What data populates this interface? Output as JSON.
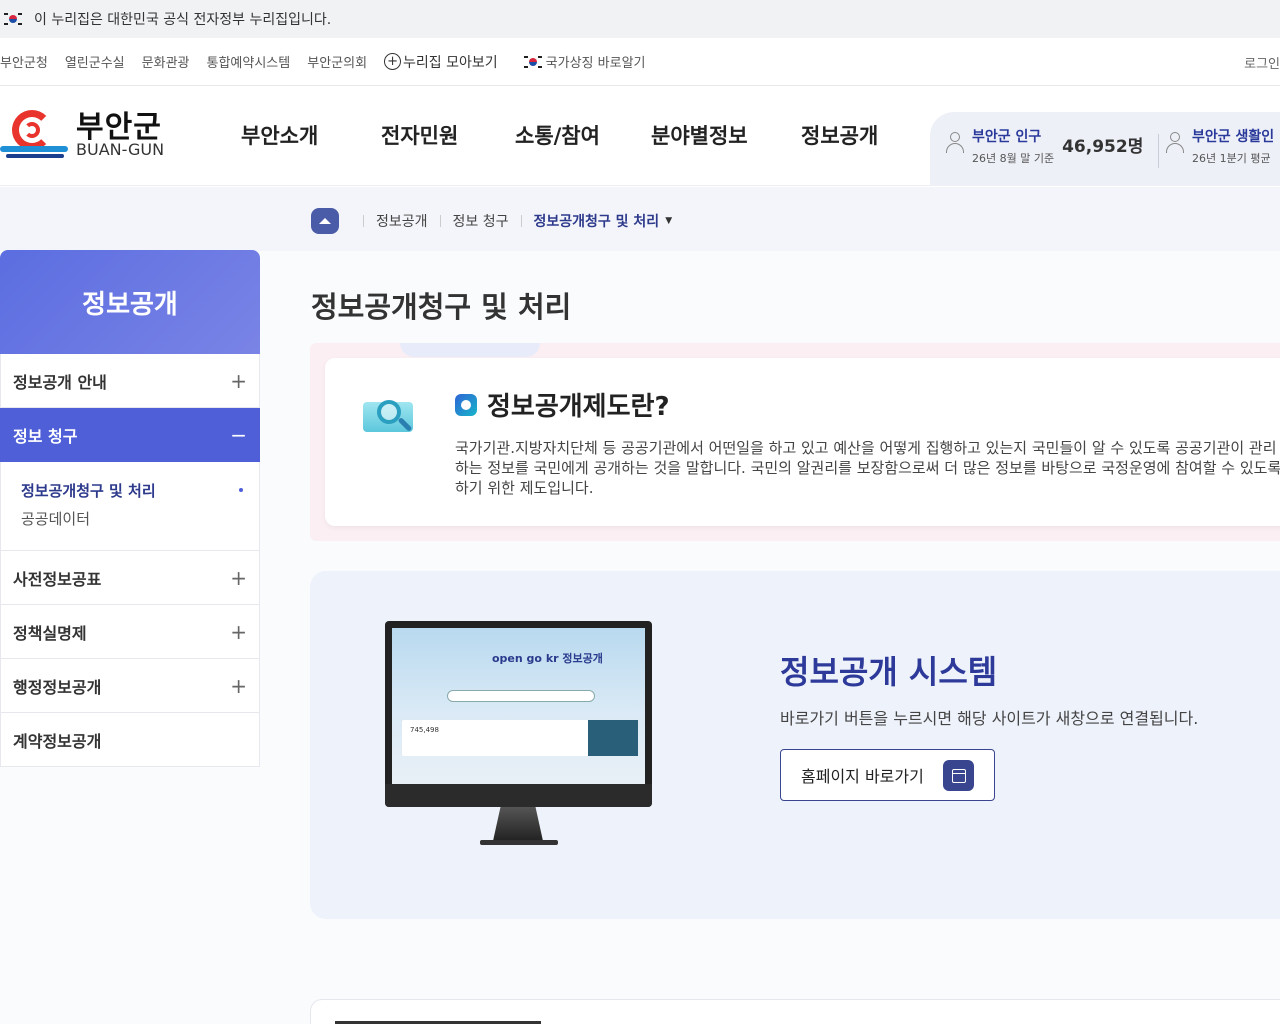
{
  "gov_banner": {
    "text": "이 누리집은 대한민국 공식 전자정부 누리집입니다."
  },
  "util_bar": {
    "links": [
      "부안군청",
      "열린군수실",
      "문화관광",
      "통합예약시스템",
      "부안군의회"
    ],
    "nurijip_all": "누리집 모아보기",
    "national_symbol": "국가상징 바로알기",
    "login": "로그인"
  },
  "logo": {
    "korean": "부안군",
    "english": "BUAN-GUN"
  },
  "gnb": {
    "items": [
      {
        "label": "부안소개"
      },
      {
        "label": "전자민원"
      },
      {
        "label": "소통/참여"
      },
      {
        "label": "분야별정보"
      },
      {
        "label": "정보공개"
      }
    ]
  },
  "stats": {
    "population": {
      "label": "부안군 인구",
      "sub": "26년 8월 말 기준",
      "value": "46,952명"
    },
    "living": {
      "label": "부안군 생활인",
      "sub": "26년 1분기 평균"
    }
  },
  "breadcrumb": {
    "items": [
      "정보공개",
      "정보 청구"
    ],
    "current": "정보공개청구 및 처리",
    "caret": "▼"
  },
  "lnb": {
    "title": "정보공개",
    "sign_plus": "+",
    "sign_minus": "−",
    "items": [
      "정보공개 안내",
      "정보 청구",
      "사전정보공표",
      "정책실명제",
      "행정정보공개",
      "계약정보공개"
    ],
    "active_sub": [
      "정보공개청구 및 처리",
      "공공데이터"
    ]
  },
  "content": {
    "title": "정보공개청구 및 처리",
    "intro_heading": "정보공개제도란?",
    "intro_text": "국가기관.지방자치단체 등 공공기관에서 어떤일을 하고 있고 예산을 어떻게 집행하고 있는지 국민들이 알 수 있도록 공공기관이 관리하는 정보를 국민에게 공개하는 것을 말합니다. 국민의 알권리를 보장함으로써 더 많은 정보를 바탕으로 국정운영에 참여할 수 있도록 하기 위한 제도입니다.",
    "system_title": "정보공개 시스템",
    "system_desc": "바로가기 버튼을 누르시면 해당 사이트가 새창으로 연결됩니다.",
    "system_button": "홈페이지 바로가기",
    "monitor_brand": "open go kr 정보공개",
    "monitor_stat": "745,498"
  },
  "colors": {
    "primary": "#4e5fd8",
    "navy": "#2d3a9a",
    "logo_red": "#e8342d",
    "logo_blue": "#1f8fd6"
  }
}
